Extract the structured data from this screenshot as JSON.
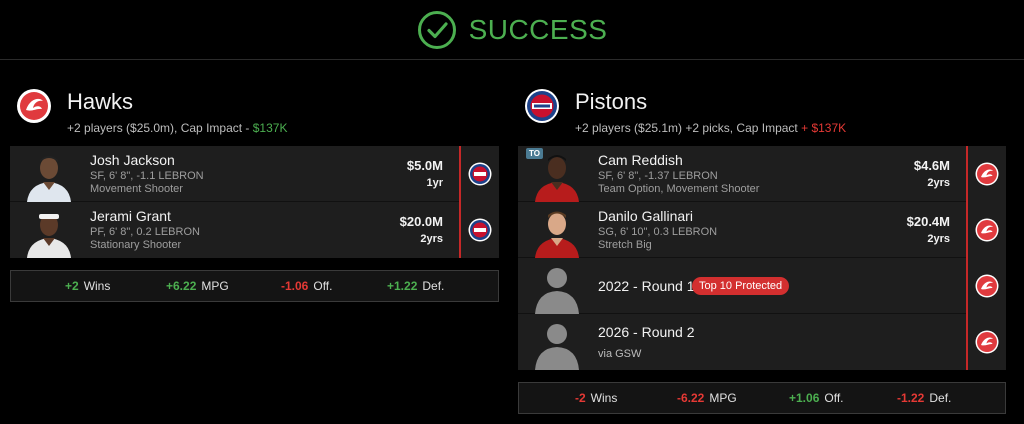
{
  "header": {
    "status": "SUCCESS",
    "icon": "check-circle-icon",
    "accent": "#4caf50"
  },
  "hawks": {
    "name": "Hawks",
    "summary": "+2 players ($25.0m), Cap Impact - ",
    "cap_change": "$137K",
    "logo": "hawks-logo-icon",
    "players": [
      {
        "name": "Josh Jackson",
        "line1": "SF, 6' 8\", -1.1 LEBRON",
        "line2": "Movement Shooter",
        "salary": "$5.0M",
        "years": "1yr",
        "destination": "pistons-logo-icon"
      },
      {
        "name": "Jerami Grant",
        "line1": "PF, 6' 8\", 0.2 LEBRON",
        "line2": "Stationary Shooter",
        "salary": "$20.0M",
        "years": "2yrs",
        "destination": "pistons-logo-icon"
      }
    ],
    "impact": {
      "wins": {
        "value": "+2",
        "label": "Wins"
      },
      "mpg": {
        "value": "+6.22",
        "label": "MPG"
      },
      "off": {
        "value": "-1.06",
        "label": "Off."
      },
      "def": {
        "value": "+1.22",
        "label": "Def."
      }
    }
  },
  "pistons": {
    "name": "Pistons",
    "summary": "+2 players ($25.1m) +2 picks, Cap Impact ",
    "cap_change": "+ $137K",
    "logo": "pistons-logo-icon",
    "players": [
      {
        "name": "Cam Reddish",
        "badge": "TO",
        "line1": "SF, 6' 8\", -1.37 LEBRON",
        "line2": "Team Option, Movement Shooter",
        "salary": "$4.6M",
        "years": "2yrs",
        "destination": "hawks-logo-icon"
      },
      {
        "name": "Danilo Gallinari",
        "line1": "SG, 6' 10\", 0.3 LEBRON",
        "line2": "Stretch Big",
        "salary": "$20.4M",
        "years": "2yrs",
        "destination": "hawks-logo-icon"
      }
    ],
    "picks": [
      {
        "title": "2022 - Round 1",
        "tag": "Top 10 Protected",
        "destination": "hawks-logo-icon"
      },
      {
        "title": "2026 - Round 2",
        "sub": "via GSW",
        "destination": "hawks-logo-icon"
      }
    ],
    "impact": {
      "wins": {
        "value": "-2",
        "label": "Wins"
      },
      "mpg": {
        "value": "-6.22",
        "label": "MPG"
      },
      "off": {
        "value": "+1.06",
        "label": "Off."
      },
      "def": {
        "value": "-1.22",
        "label": "Def."
      }
    }
  },
  "colors": {
    "positive": "#4caf50",
    "negative": "#e53935",
    "hawks_red": "#e03a3e",
    "pistons_blue": "#1d428a"
  }
}
